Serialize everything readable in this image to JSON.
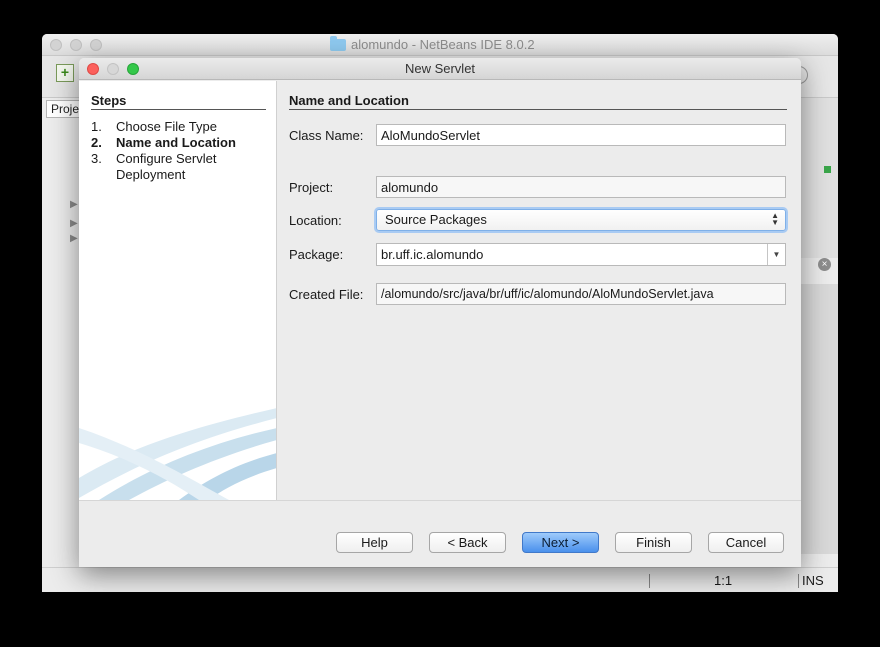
{
  "ide": {
    "title": "alomundo - NetBeans IDE 8.0.2",
    "projects_tab": "Proje",
    "status": {
      "position": "1:1",
      "mode": "INS"
    }
  },
  "dialog": {
    "title": "New Servlet",
    "steps": {
      "heading": "Steps",
      "items": [
        {
          "num": "1.",
          "label": "Choose File Type"
        },
        {
          "num": "2.",
          "label": "Name and Location"
        },
        {
          "num": "3.",
          "label": "Configure Servlet Deployment"
        }
      ]
    },
    "form": {
      "heading": "Name and Location",
      "class_name": {
        "label": "Class Name:",
        "value": "AloMundoServlet"
      },
      "project": {
        "label": "Project:",
        "value": "alomundo"
      },
      "location": {
        "label": "Location:",
        "value": "Source Packages"
      },
      "package": {
        "label": "Package:",
        "value": "br.uff.ic.alomundo"
      },
      "created_file": {
        "label": "Created File:",
        "value": "/alomundo/src/java/br/uff/ic/alomundo/AloMundoServlet.java"
      }
    },
    "buttons": {
      "help": "Help",
      "back": "< Back",
      "next": "Next >",
      "finish": "Finish",
      "cancel": "Cancel"
    }
  }
}
